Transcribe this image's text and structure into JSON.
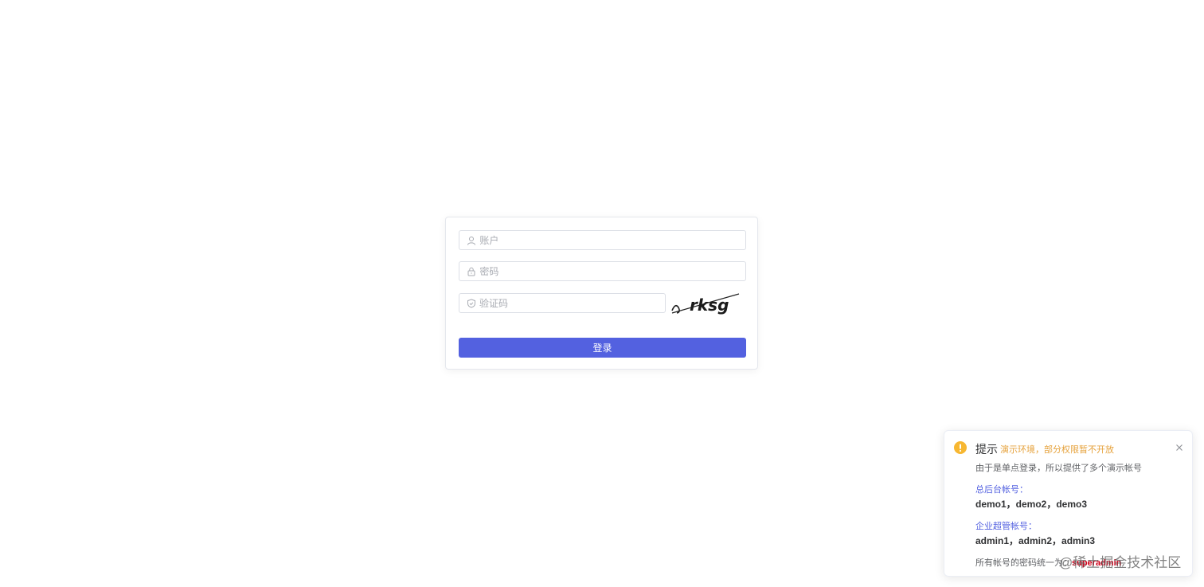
{
  "login": {
    "account_placeholder": "账户",
    "password_placeholder": "密码",
    "captcha_placeholder": "验证码",
    "captcha_text": "rksg",
    "login_label": "登录",
    "button_color": "#5361e0"
  },
  "notification": {
    "title": "提示",
    "subtitle": "演示环境，部分权限暂不开放",
    "line1": "由于是单点登录，所以提供了多个演示帐号",
    "group1_label": "总后台帐号：",
    "group1_accounts": "demo1，demo2，demo3",
    "group2_label": "企业超管帐号：",
    "group2_accounts": "admin1，admin2，admin3",
    "password_note": "所有帐号的密码统一为：",
    "password_value": "superadmin",
    "icons": [
      "warning-icon",
      "close-icon"
    ]
  },
  "watermark": "@稀土掘金技术社区"
}
